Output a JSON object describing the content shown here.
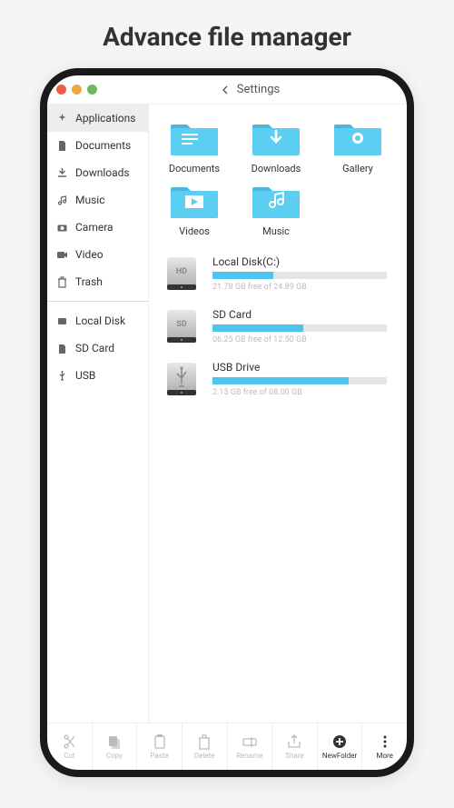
{
  "page_title": "Advance file manager",
  "topbar": {
    "back_label": "Settings"
  },
  "sidebar": {
    "items": [
      {
        "label": "Applications",
        "icon": "sparkle",
        "active": true
      },
      {
        "label": "Documents",
        "icon": "doc"
      },
      {
        "label": "Downloads",
        "icon": "download"
      },
      {
        "label": "Music",
        "icon": "music"
      },
      {
        "label": "Camera",
        "icon": "camera"
      },
      {
        "label": "Video",
        "icon": "video"
      },
      {
        "label": "Trash",
        "icon": "trash"
      }
    ],
    "storage": [
      {
        "label": "Local Disk",
        "icon": "localdisk"
      },
      {
        "label": "SD Card",
        "icon": "sdcard"
      },
      {
        "label": "USB",
        "icon": "usb"
      }
    ]
  },
  "folders": [
    {
      "label": "Documents",
      "glyph": "doc"
    },
    {
      "label": "Downloads",
      "glyph": "download"
    },
    {
      "label": "Gallery",
      "glyph": "gallery"
    },
    {
      "label": "Videos",
      "glyph": "video"
    },
    {
      "label": "Music",
      "glyph": "music"
    }
  ],
  "drives": [
    {
      "name": "Local Disk(C:)",
      "badge": "HD",
      "used": 21.78,
      "total": 24.89,
      "free_text": "21.78 GB free of 24.89 GB",
      "percent": 35
    },
    {
      "name": "SD Card",
      "badge": "SD",
      "used": 6.25,
      "total": 12.5,
      "free_text": "06.25 GB free of 12.50 GB",
      "percent": 52
    },
    {
      "name": "USB Drive",
      "badge": "usb",
      "used": 2.15,
      "total": 8.0,
      "free_text": "2.15 GB free of 08.00 GB",
      "percent": 78
    }
  ],
  "bottombar": [
    {
      "label": "Cut",
      "icon": "cut"
    },
    {
      "label": "Copy",
      "icon": "copy"
    },
    {
      "label": "Paste",
      "icon": "paste"
    },
    {
      "label": "Delete",
      "icon": "delete"
    },
    {
      "label": "Rename",
      "icon": "rename"
    },
    {
      "label": "Share",
      "icon": "share"
    },
    {
      "label": "NewFolder",
      "icon": "newfolder",
      "dark": true
    },
    {
      "label": "More",
      "icon": "more",
      "dark": true
    }
  ],
  "colors": {
    "folder": "#5bcef2",
    "accent": "#4fc4ec"
  }
}
